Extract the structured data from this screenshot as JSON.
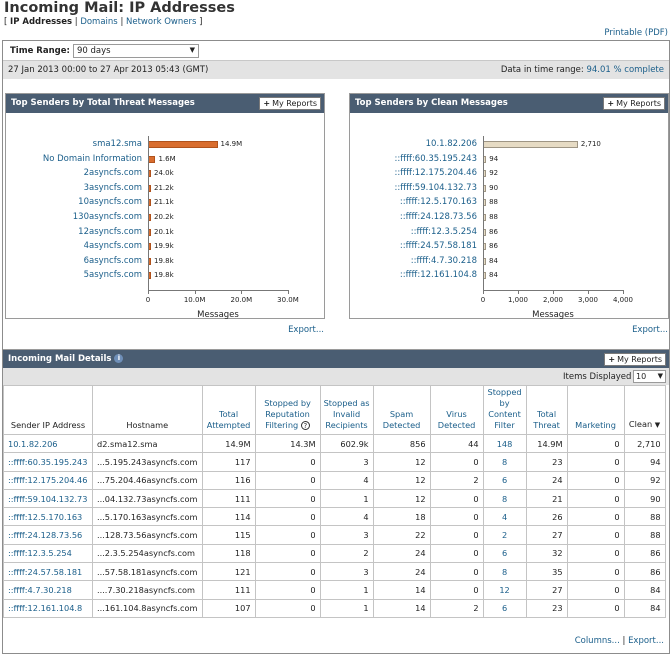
{
  "page": {
    "title": "Incoming Mail: IP Addresses",
    "nav": {
      "open": "[",
      "current": "IP Addresses",
      "sep": "|",
      "domains": "Domains",
      "network_owners": "Network Owners",
      "close": "]"
    },
    "printable": "Printable (PDF)"
  },
  "time_range": {
    "label": "Time Range:",
    "value": "90 days"
  },
  "date_range": "27 Jan 2013 00:00 to 27 Apr 2013 05:43 (GMT)",
  "data_in_range": {
    "prefix": "Data in time range:",
    "value": "94.01 % complete"
  },
  "my_reports_label": "My Reports",
  "export_label": "Export...",
  "chart_data": [
    {
      "type": "bar",
      "orientation": "horizontal",
      "title": "Top Senders by Total Threat Messages",
      "categories": [
        "sma12.sma",
        "No Domain Information",
        "2asyncfs.com",
        "3asyncfs.com",
        "10asyncfs.com",
        "130asyncfs.com",
        "12asyncfs.com",
        "4asyncfs.com",
        "6asyncfs.com",
        "5asyncfs.com"
      ],
      "values": [
        14900000,
        1600000,
        24000,
        21200,
        21100,
        20200,
        20100,
        19900,
        19800,
        19800
      ],
      "value_labels": [
        "14.9M",
        "1.6M",
        "24.0k",
        "21.2k",
        "21.1k",
        "20.2k",
        "20.1k",
        "19.9k",
        "19.8k",
        "19.8k"
      ],
      "xlabel": "Messages",
      "xlim": [
        0,
        30000000
      ],
      "ticks": [
        0,
        10000000,
        20000000,
        30000000
      ],
      "tick_labels": [
        "0",
        "10.0M",
        "20.0M",
        "30.0M"
      ],
      "color": "#d96d2e"
    },
    {
      "type": "bar",
      "orientation": "horizontal",
      "title": "Top Senders by Clean Messages",
      "categories": [
        "10.1.82.206",
        "::ffff:60.35.195.243",
        "::ffff:12.175.204.46",
        "::ffff:59.104.132.73",
        "::ffff:12.5.170.163",
        "::ffff:24.128.73.56",
        "::ffff:12.3.5.254",
        "::ffff:24.57.58.181",
        "::ffff:4.7.30.218",
        "::ffff:12.161.104.8"
      ],
      "values": [
        2710,
        94,
        92,
        90,
        88,
        88,
        86,
        86,
        84,
        84
      ],
      "value_labels": [
        "2,710",
        "94",
        "92",
        "90",
        "88",
        "88",
        "86",
        "86",
        "84",
        "84"
      ],
      "xlabel": "Messages",
      "xlim": [
        0,
        4000
      ],
      "ticks": [
        0,
        1000,
        2000,
        3000,
        4000
      ],
      "tick_labels": [
        "0",
        "1,000",
        "2,000",
        "3,000",
        "4,000"
      ],
      "color": "#e6dbc4"
    }
  ],
  "details": {
    "title": "Incoming Mail Details",
    "info_icon": "i",
    "items_label": "Items Displayed",
    "items_value": "10",
    "columns_link": "Columns...",
    "export_link": "Export...",
    "headers": [
      "Sender IP Address",
      "Hostname",
      "Total Attempted",
      "Stopped by Reputation Filtering",
      "Stopped as Invalid Recipients",
      "Spam Detected",
      "Virus Detected",
      "Stopped by Content Filter",
      "Total Threat",
      "Marketing",
      "Clean"
    ],
    "help_icon": "?",
    "sort_arrow": "▼",
    "rows": [
      [
        "10.1.82.206",
        "d2.sma12.sma",
        "14.9M",
        "14.3M",
        "602.9k",
        "856",
        "44",
        "148",
        "14.9M",
        "0",
        "2,710"
      ],
      [
        "::ffff:60.35.195.243",
        "...5.195.243asyncfs.com",
        "117",
        "0",
        "3",
        "12",
        "0",
        "8",
        "23",
        "0",
        "94"
      ],
      [
        "::ffff:12.175.204.46",
        "...75.204.46asyncfs.com",
        "116",
        "0",
        "4",
        "12",
        "2",
        "6",
        "24",
        "0",
        "92"
      ],
      [
        "::ffff:59.104.132.73",
        "...04.132.73asyncfs.com",
        "111",
        "0",
        "1",
        "12",
        "0",
        "8",
        "21",
        "0",
        "90"
      ],
      [
        "::ffff:12.5.170.163",
        "...5.170.163asyncfs.com",
        "114",
        "0",
        "4",
        "18",
        "0",
        "4",
        "26",
        "0",
        "88"
      ],
      [
        "::ffff:24.128.73.56",
        "...128.73.56asyncfs.com",
        "115",
        "0",
        "3",
        "22",
        "0",
        "2",
        "27",
        "0",
        "88"
      ],
      [
        "::ffff:12.3.5.254",
        "...2.3.5.254asyncfs.com",
        "118",
        "0",
        "2",
        "24",
        "0",
        "6",
        "32",
        "0",
        "86"
      ],
      [
        "::ffff:24.57.58.181",
        "...57.58.181asyncfs.com",
        "121",
        "0",
        "3",
        "24",
        "0",
        "8",
        "35",
        "0",
        "86"
      ],
      [
        "::ffff:4.7.30.218",
        "....7.30.218asyncfs.com",
        "111",
        "0",
        "1",
        "14",
        "0",
        "12",
        "27",
        "0",
        "84"
      ],
      [
        "::ffff:12.161.104.8",
        "...161.104.8asyncfs.com",
        "107",
        "0",
        "1",
        "14",
        "2",
        "6",
        "23",
        "0",
        "84"
      ]
    ]
  }
}
